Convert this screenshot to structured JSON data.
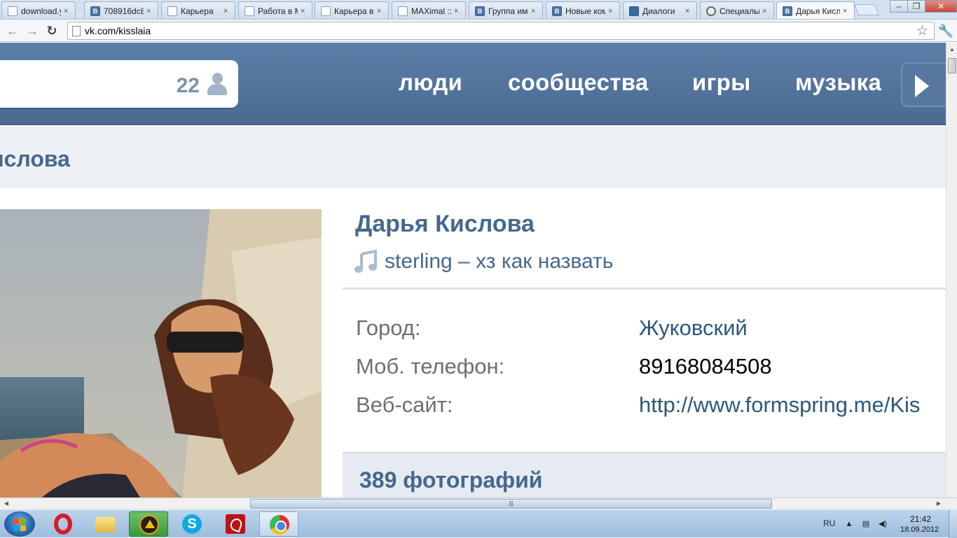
{
  "browser": {
    "tabs": [
      {
        "label": "download.y",
        "icon": "page-icon"
      },
      {
        "label": "708916dc89",
        "icon": "vk-icon"
      },
      {
        "label": "Карьера",
        "icon": "page-icon"
      },
      {
        "label": "Работа в M",
        "icon": "page-icon"
      },
      {
        "label": "Карьера в",
        "icon": "page-icon"
      },
      {
        "label": "MAXimal ::",
        "icon": "page-icon"
      },
      {
        "label": "Группа име",
        "icon": "vk-icon"
      },
      {
        "label": "Новые ком",
        "icon": "vk-icon"
      },
      {
        "label": "Диалоги",
        "icon": "chat-icon"
      },
      {
        "label": "Специальн",
        "icon": "opera-icon"
      },
      {
        "label": "Дарья Кисл",
        "icon": "vk-icon"
      }
    ],
    "tab_close_glyph": "×",
    "favicon_letter": "B",
    "url": "vk.com/kisslaia"
  },
  "vk": {
    "friends_online_count": "22",
    "nav": [
      "люди",
      "сообщества",
      "игры",
      "музыка"
    ],
    "name_bar": "ислова",
    "profile": {
      "name": "Дарья Кислова",
      "status": "sterling – хз как назвать",
      "info": [
        {
          "label": "Город:",
          "value": "Жуковский",
          "style": "link"
        },
        {
          "label": "Моб. телефон:",
          "value": "89168084508",
          "style": "plain"
        },
        {
          "label": "Веб-сайт:",
          "value": "http://www.formspring.me/Kis",
          "style": "link"
        }
      ],
      "photos_count": "389 фотографий"
    }
  },
  "taskbar": {
    "language": "RU",
    "time": "21:42",
    "date": "18.09.2012"
  },
  "colors": {
    "vk_header": "#4d6d96",
    "vk_link": "#45688e",
    "vk_light_bg": "#edf1f5"
  }
}
